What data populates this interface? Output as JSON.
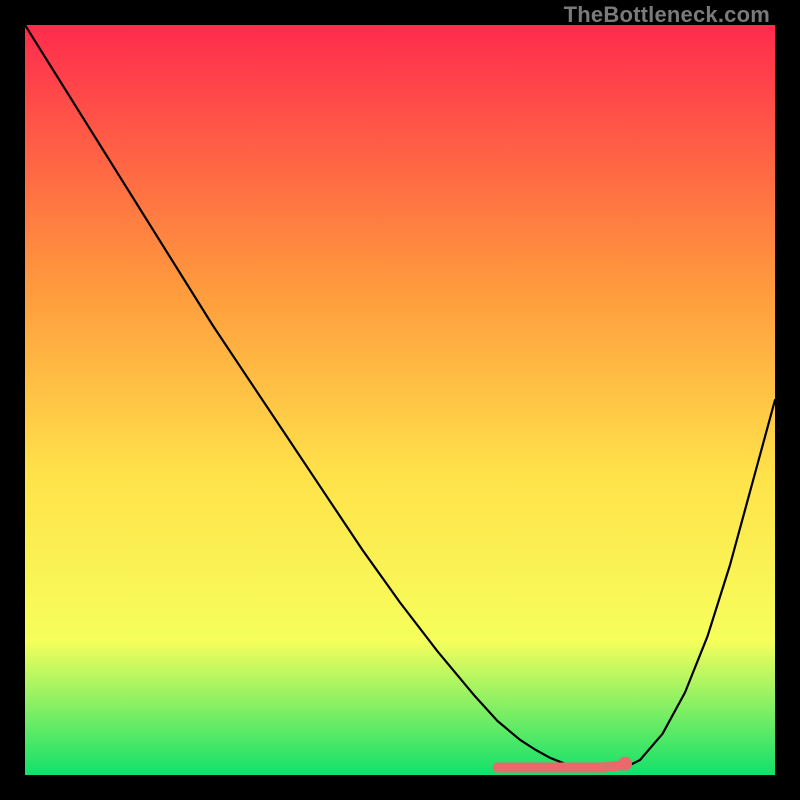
{
  "watermark": "TheBottleneck.com",
  "gradient": {
    "top": "#ff2b4d",
    "mid_upper": "#ff9a3d",
    "mid": "#ffe24a",
    "mid_lower": "#f6ff5c",
    "bottom": "#11e06b"
  },
  "curve_color": "#000000",
  "marker_color": "#e86a6a",
  "chart_data": {
    "type": "line",
    "title": "",
    "xlabel": "",
    "ylabel": "",
    "xlim": [
      0,
      100
    ],
    "ylim": [
      0,
      100
    ],
    "grid": false,
    "series": [
      {
        "name": "bottleneck-curve",
        "x": [
          0,
          5,
          10,
          15,
          20,
          25,
          30,
          35,
          40,
          45,
          50,
          55,
          60,
          63,
          66,
          68,
          70,
          72,
          74,
          76,
          78,
          80,
          82,
          85,
          88,
          91,
          94,
          97,
          100
        ],
        "y": [
          100,
          92,
          84,
          76,
          68,
          60,
          52.5,
          45,
          37.5,
          30,
          23,
          16.5,
          10.5,
          7.2,
          4.7,
          3.4,
          2.3,
          1.5,
          1.0,
          0.7,
          0.7,
          1.0,
          2.0,
          5.5,
          11.0,
          18.5,
          28.0,
          39.0,
          50.0
        ]
      }
    ],
    "markers": {
      "name": "highlight-range",
      "x": [
        63,
        65,
        67,
        69,
        71,
        73,
        75,
        77,
        79,
        80
      ],
      "y": [
        1.0,
        1.0,
        1.0,
        1.0,
        1.0,
        1.0,
        1.0,
        1.0,
        1.2,
        1.5
      ]
    }
  }
}
